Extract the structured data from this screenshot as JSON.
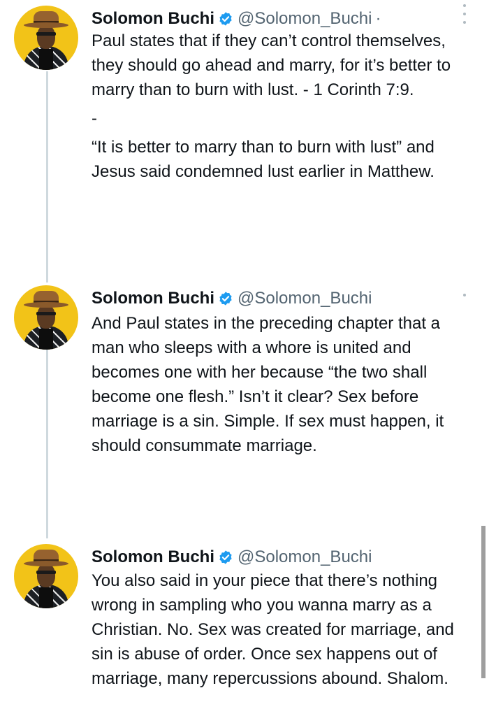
{
  "colors": {
    "text": "#0f1419",
    "secondary": "#536471",
    "verified": "#1d9bf0",
    "thread_line": "#cfd9de"
  },
  "tweets": [
    {
      "name": "Solomon Buchi",
      "handle": "@Solomon_Buchi",
      "separator": "·",
      "verified_icon": "verified-badge-icon",
      "paragraphs": [
        "Paul states that if they can’t control themselves, they should go ahead and marry, for it’s better to marry than to burn with lust. - 1 Corinth 7:9.",
        "-",
        "“It is better to marry than to burn with lust” and Jesus said condemned lust earlier in Matthew."
      ]
    },
    {
      "name": "Solomon Buchi",
      "handle": "@Solomon_Buchi",
      "verified_icon": "verified-badge-icon",
      "paragraphs": [
        "And Paul states in the preceding chapter that a man who sleeps with a whore is united and becomes one with her because “the two shall become one flesh.” Isn’t it clear? Sex before marriage is a sin. Simple. If sex must happen, it should consummate marriage."
      ]
    },
    {
      "name": "Solomon Buchi",
      "handle": "@Solomon_Buchi",
      "verified_icon": "verified-badge-icon",
      "paragraphs": [
        "You also said in your piece that there’s nothing wrong in sampling who you wanna marry as a Christian.  No. Sex was created for marriage, and sin is abuse of order. Once sex happens out of marriage, many repercussions abound. Shalom."
      ]
    }
  ]
}
